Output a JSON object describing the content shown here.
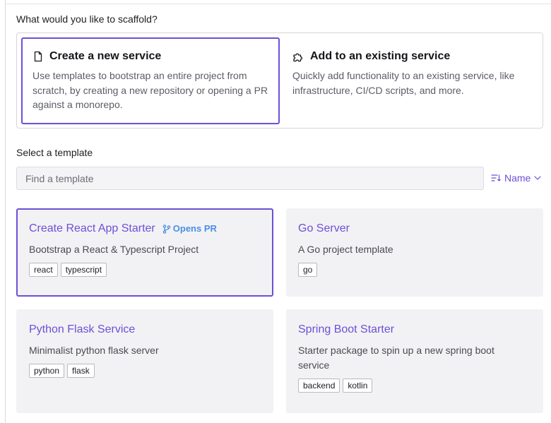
{
  "heading": "What would you like to scaffold?",
  "scaffold_options": [
    {
      "title": "Create a new service",
      "description": "Use templates to bootstrap an entire project from scratch, by creating a new repository or opening a PR against a monorepo.",
      "icon": "file-icon",
      "selected": true
    },
    {
      "title": "Add to an existing service",
      "description": "Quickly add functionality to an existing service, like infrastructure, CI/CD scripts, and more.",
      "icon": "puzzle-icon",
      "selected": false
    }
  ],
  "template_section": {
    "label": "Select a template",
    "search_placeholder": "Find a template",
    "sort_label": "Name"
  },
  "templates": [
    {
      "title": "Create React App Starter",
      "badge": "Opens PR",
      "description": "Bootstrap a React & Typescript Project",
      "tags": [
        "react",
        "typescript"
      ],
      "selected": true
    },
    {
      "title": "Go Server",
      "description": "A Go project template",
      "tags": [
        "go"
      ]
    },
    {
      "title": "Python Flask Service",
      "description": "Minimalist python flask server",
      "tags": [
        "python",
        "flask"
      ]
    },
    {
      "title": "Spring Boot Starter",
      "description": "Starter package to spin up a new spring boot service",
      "tags": [
        "backend",
        "kotlin"
      ]
    }
  ],
  "colors": {
    "accent": "#6e4fd6",
    "badge": "#4a8ee8",
    "card_bg": "#f2f2f4"
  }
}
